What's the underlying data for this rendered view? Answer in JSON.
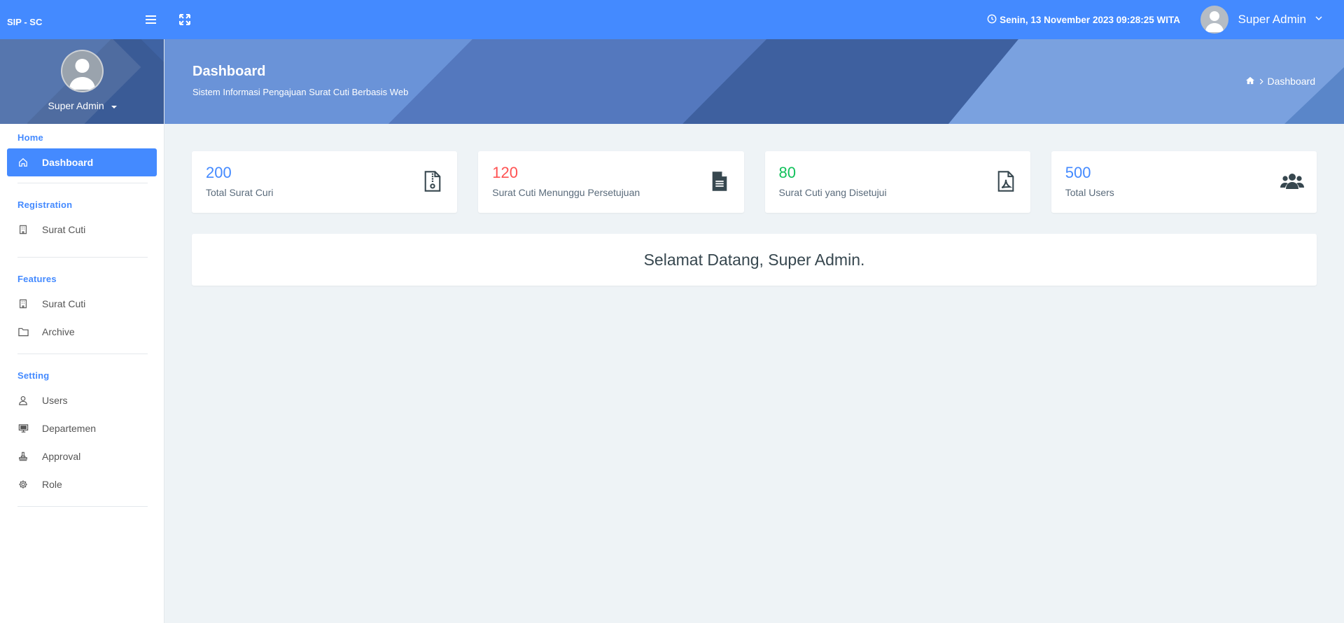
{
  "topbar": {
    "brand": "SIP - SC",
    "datetime": "Senin, 13 November 2023 09:28:25 WITA",
    "user_name": "Super Admin",
    "icons": [
      "menu-icon",
      "fullscreen-icon",
      "clock-icon",
      "chevron-down-icon"
    ]
  },
  "sidebar": {
    "user_name": "Super Admin",
    "sections": [
      {
        "title": "Home",
        "items": [
          {
            "label": "Dashboard",
            "icon": "home-icon",
            "active": true
          }
        ]
      },
      {
        "title": "Registration",
        "items": [
          {
            "label": "Surat Cuti",
            "icon": "building-icon"
          }
        ]
      },
      {
        "title": "Features",
        "items": [
          {
            "label": "Surat Cuti",
            "icon": "building-icon"
          },
          {
            "label": "Archive",
            "icon": "folder-icon"
          }
        ]
      },
      {
        "title": "Setting",
        "items": [
          {
            "label": "Users",
            "icon": "user-icon"
          },
          {
            "label": "Departemen",
            "icon": "monitor-icon"
          },
          {
            "label": "Approval",
            "icon": "stamp-icon"
          },
          {
            "label": "Role",
            "icon": "gear-icon"
          }
        ]
      }
    ]
  },
  "page_header": {
    "title": "Dashboard",
    "subtitle": "Sistem Informasi Pengajuan Surat Cuti Berbasis Web",
    "breadcrumb": "Dashboard"
  },
  "cards": [
    {
      "value": "200",
      "label": "Total Surat Curi",
      "color": "#448aff",
      "icon": "zip-file-icon"
    },
    {
      "value": "120",
      "label": "Surat Cuti Menunggu Persetujuan",
      "color": "#ff5252",
      "icon": "document-icon"
    },
    {
      "value": "80",
      "label": "Surat Cuti yang Disetujui",
      "color": "#11c15b",
      "icon": "pdf-file-icon"
    },
    {
      "value": "500",
      "label": "Total Users",
      "color": "#448aff",
      "icon": "users-icon"
    }
  ],
  "welcome": "Selamat Datang, Super Admin.",
  "colors": {
    "primary": "#448aff",
    "page_bg": "#eef3f6",
    "header_bg": "#5b82c9"
  }
}
